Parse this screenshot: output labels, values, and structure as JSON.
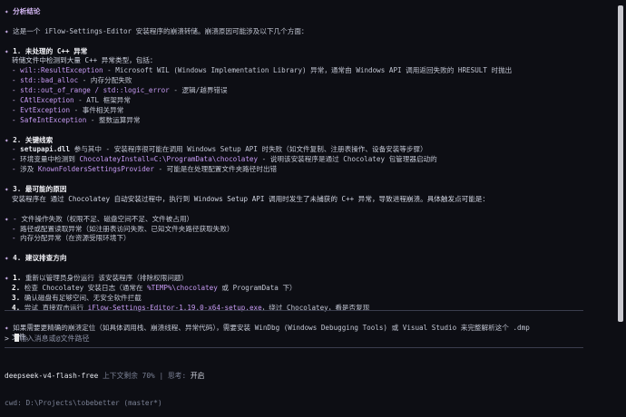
{
  "content": {
    "title_icon": "✦",
    "title": "分析结论",
    "intro": "这是一个 iFlow-Settings-Editor 安装程序的崩溃转储。崩溃原因可能涉及以下几个方面：",
    "section1": {
      "label": "1. 未处理的 C++ 异常",
      "desc": "转储文件中检测到大量 C++ 异常类型，包括：",
      "items": [
        {
          "code": "wil::ResultException",
          "text": " - Microsoft WIL (Windows Implementation Library) 异常，通常由 Windows API 调用返回失败的 HRESULT 时抛出"
        },
        {
          "code": "std::bad_alloc",
          "text": " - 内存分配失败"
        },
        {
          "code": "std::out_of_range / std::logic_error",
          "text": " - 逻辑/越界错误"
        },
        {
          "code": "CAtlException",
          "text": " - ATL 框架异常"
        },
        {
          "code": "EvtException",
          "text": " - 事件相关异常"
        },
        {
          "code": "SafeIntException",
          "text": " - 整数运算异常"
        }
      ]
    },
    "section2": {
      "label": "2. 关键线索",
      "items": [
        {
          "bold": "setupapi.dll",
          "text": " 参与其中 - 安装程序很可能在调用 Windows Setup API 时失败（如文件复制、注册表操作、设备安装等步骤）"
        },
        {
          "pre": "环境变量中检测到 ",
          "code": "ChocolateyInstall=C:\\ProgramData\\chocolatey",
          "text": " - 说明该安装程序是通过 Chocolatey 包管理器启动的"
        },
        {
          "pre": "涉及 ",
          "code": "KnownFoldersSettingsProvider",
          "text": " - 可能是在处理配置文件夹路径时出错"
        }
      ]
    },
    "section3": {
      "label": "3. 最可能的原因",
      "desc": "安装程序在 通过 Chocolatey 自动安装过程中，执行到 Windows Setup API 调用时发生了未捕获的 C++ 异常，导致进程崩溃。具体触发点可能是：",
      "items": [
        "文件操作失败（权限不足、磁盘空间不足、文件被占用）",
        "路径或配置读取异常（如注册表访问失败、已知文件夹路径获取失败）",
        "内存分配异常（在资源受限环境下）"
      ]
    },
    "section4": {
      "label": "4. 建议排查方向",
      "items": [
        {
          "n": "1.",
          "text": "重新以管理员身份运行 该安装程序（排除权限问题）"
        },
        {
          "n": "2.",
          "pre": "检查 Chocolatey 安装日志（通常在 ",
          "code": "%TEMP%\\chocolatey",
          "text": " 或 ProgramData 下）"
        },
        {
          "n": "3.",
          "text": "确认磁盘有足够空间、无安全软件拦截"
        },
        {
          "n": "4.",
          "pre": "尝试 直接双击运行 ",
          "code": "iFlow-Settings-Editor-1.19.0-x64-setup.exe",
          "text": "，绕过 Chocolatey，看是否复现"
        }
      ]
    },
    "closing_1": "如果需要更精确的崩溃定位（如具体调用栈、崩溃线程、异常代码），需要安装 WinDbg (Windows Debugging Tools) 或 Visual Studio 来完整解析这个 .dmp",
    "closing_2": "文件。"
  },
  "input": {
    "prompt_symbol": ">",
    "placeholder": "输入消息或@文件路径"
  },
  "status": {
    "model": "deepseek-v4-flash-free",
    "context": "上下文剩余 70%",
    "sep": "|",
    "thinking_label": "思考:",
    "thinking_value": "开启",
    "cwd": "cwd: D:\\Projects\\tobebetter (master*)"
  }
}
